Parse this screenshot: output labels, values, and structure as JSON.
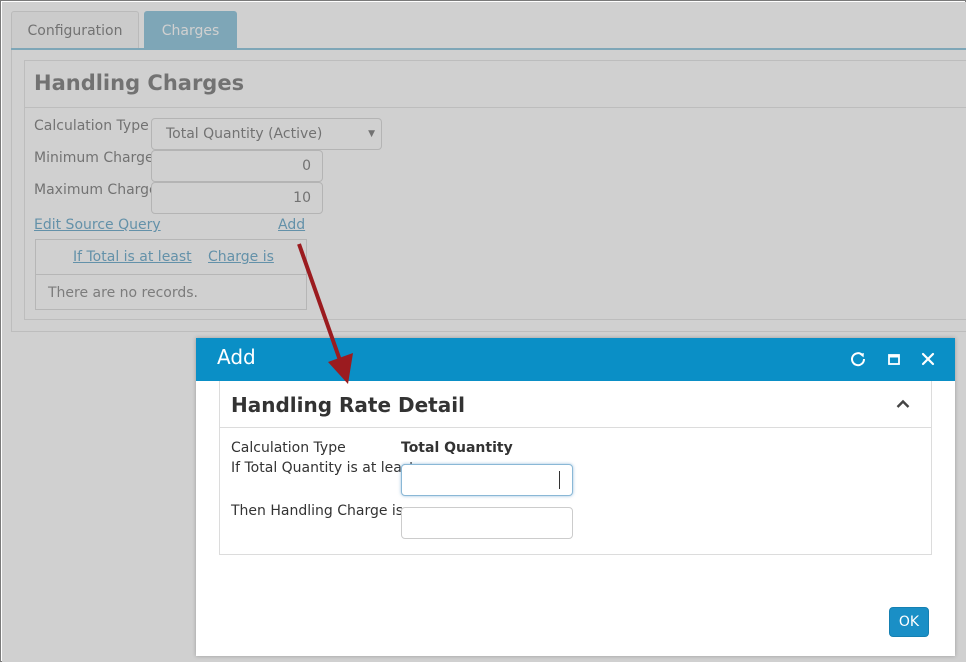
{
  "tabs": [
    {
      "label": "Configuration",
      "active": false
    },
    {
      "label": "Charges",
      "active": true
    }
  ],
  "handling_charges": {
    "title": "Handling Charges",
    "calculation_type_label": "Calculation Type",
    "calculation_type_value": "Total Quantity (Active)",
    "minimum_charge_label": "Minimum Charge",
    "minimum_charge_value": "0",
    "maximum_charge_label": "Maximum Charge",
    "maximum_charge_value": "10",
    "edit_source_query_label": "Edit Source Query",
    "add_label": "Add",
    "grid": {
      "columns": [
        "If Total is at least",
        "Charge is"
      ],
      "empty_text": "There are no records."
    }
  },
  "modal": {
    "title": "Add",
    "icons": [
      "refresh-icon",
      "maximize-icon",
      "close-icon"
    ],
    "section_title": "Handling Rate Detail",
    "section_icon": "chevron-up-icon",
    "calculation_type_label": "Calculation Type",
    "calculation_type_value": "Total Quantity",
    "min_total_label": "If Total Quantity is at least",
    "min_total_value": "",
    "charge_label": "Then Handling Charge is",
    "charge_value": "",
    "ok_label": "OK"
  },
  "colors": {
    "accent": "#0a8fc6",
    "tab_active": "#6bb3d1",
    "link": "#3a8cb8",
    "annotation_arrow": "#9b1b1f"
  }
}
